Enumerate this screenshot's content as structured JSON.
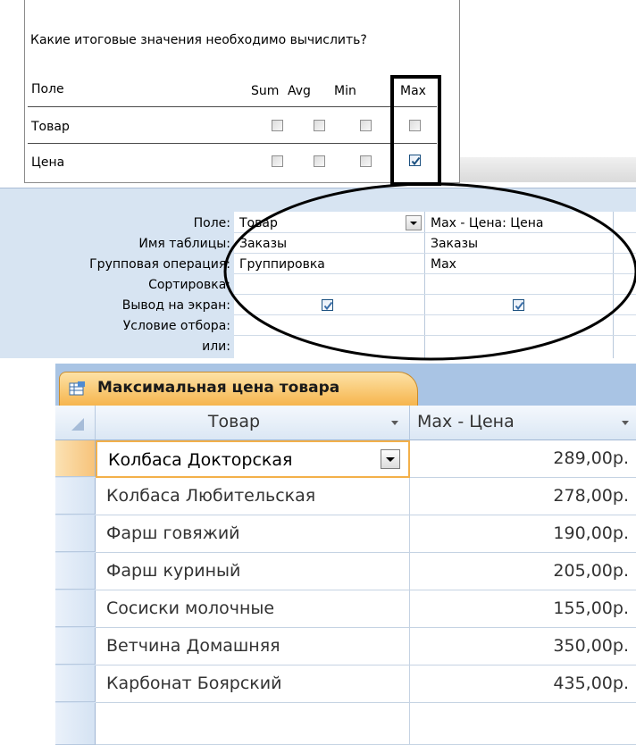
{
  "summary_panel": {
    "question": "Какие итоговые значения необходимо вычислить?",
    "field_header": "Поле",
    "columns": [
      "Sum",
      "Avg",
      "Min",
      "Max"
    ],
    "rows": [
      {
        "label": "Товар",
        "checked": [
          false,
          false,
          false,
          false
        ]
      },
      {
        "label": "Цена",
        "checked": [
          false,
          false,
          false,
          true
        ]
      }
    ]
  },
  "design_grid": {
    "row_labels": [
      "Поле:",
      "Имя таблицы:",
      "Групповая операция:",
      "Сортировка:",
      "Вывод на экран:",
      "Условие отбора:",
      "или:"
    ],
    "col1": {
      "field": "Товар",
      "table": "Заказы",
      "group": "Группировка",
      "show": true
    },
    "col2": {
      "field": "Max - Цена: Цена",
      "table": "Заказы",
      "group": "Max",
      "show": true
    }
  },
  "datasheet": {
    "tab_title": "Максимальная цена товара",
    "headers": [
      "Товар",
      "Max - Цена"
    ],
    "rows": [
      {
        "product": "Колбаса Докторская",
        "price": "289,00р."
      },
      {
        "product": "Колбаса Любительская",
        "price": "278,00р."
      },
      {
        "product": "Фарш говяжий",
        "price": "190,00р."
      },
      {
        "product": "Фарш куриный",
        "price": "205,00р."
      },
      {
        "product": "Сосиски молочные",
        "price": "155,00р."
      },
      {
        "product": "Ветчина Домашняя",
        "price": "350,00р."
      },
      {
        "product": "Карбонат Боярский",
        "price": "435,00р."
      }
    ]
  },
  "colors": {
    "accent_tab": "#f6b54d",
    "grid_bg": "#d7e4f2",
    "check": "#1c5180"
  }
}
